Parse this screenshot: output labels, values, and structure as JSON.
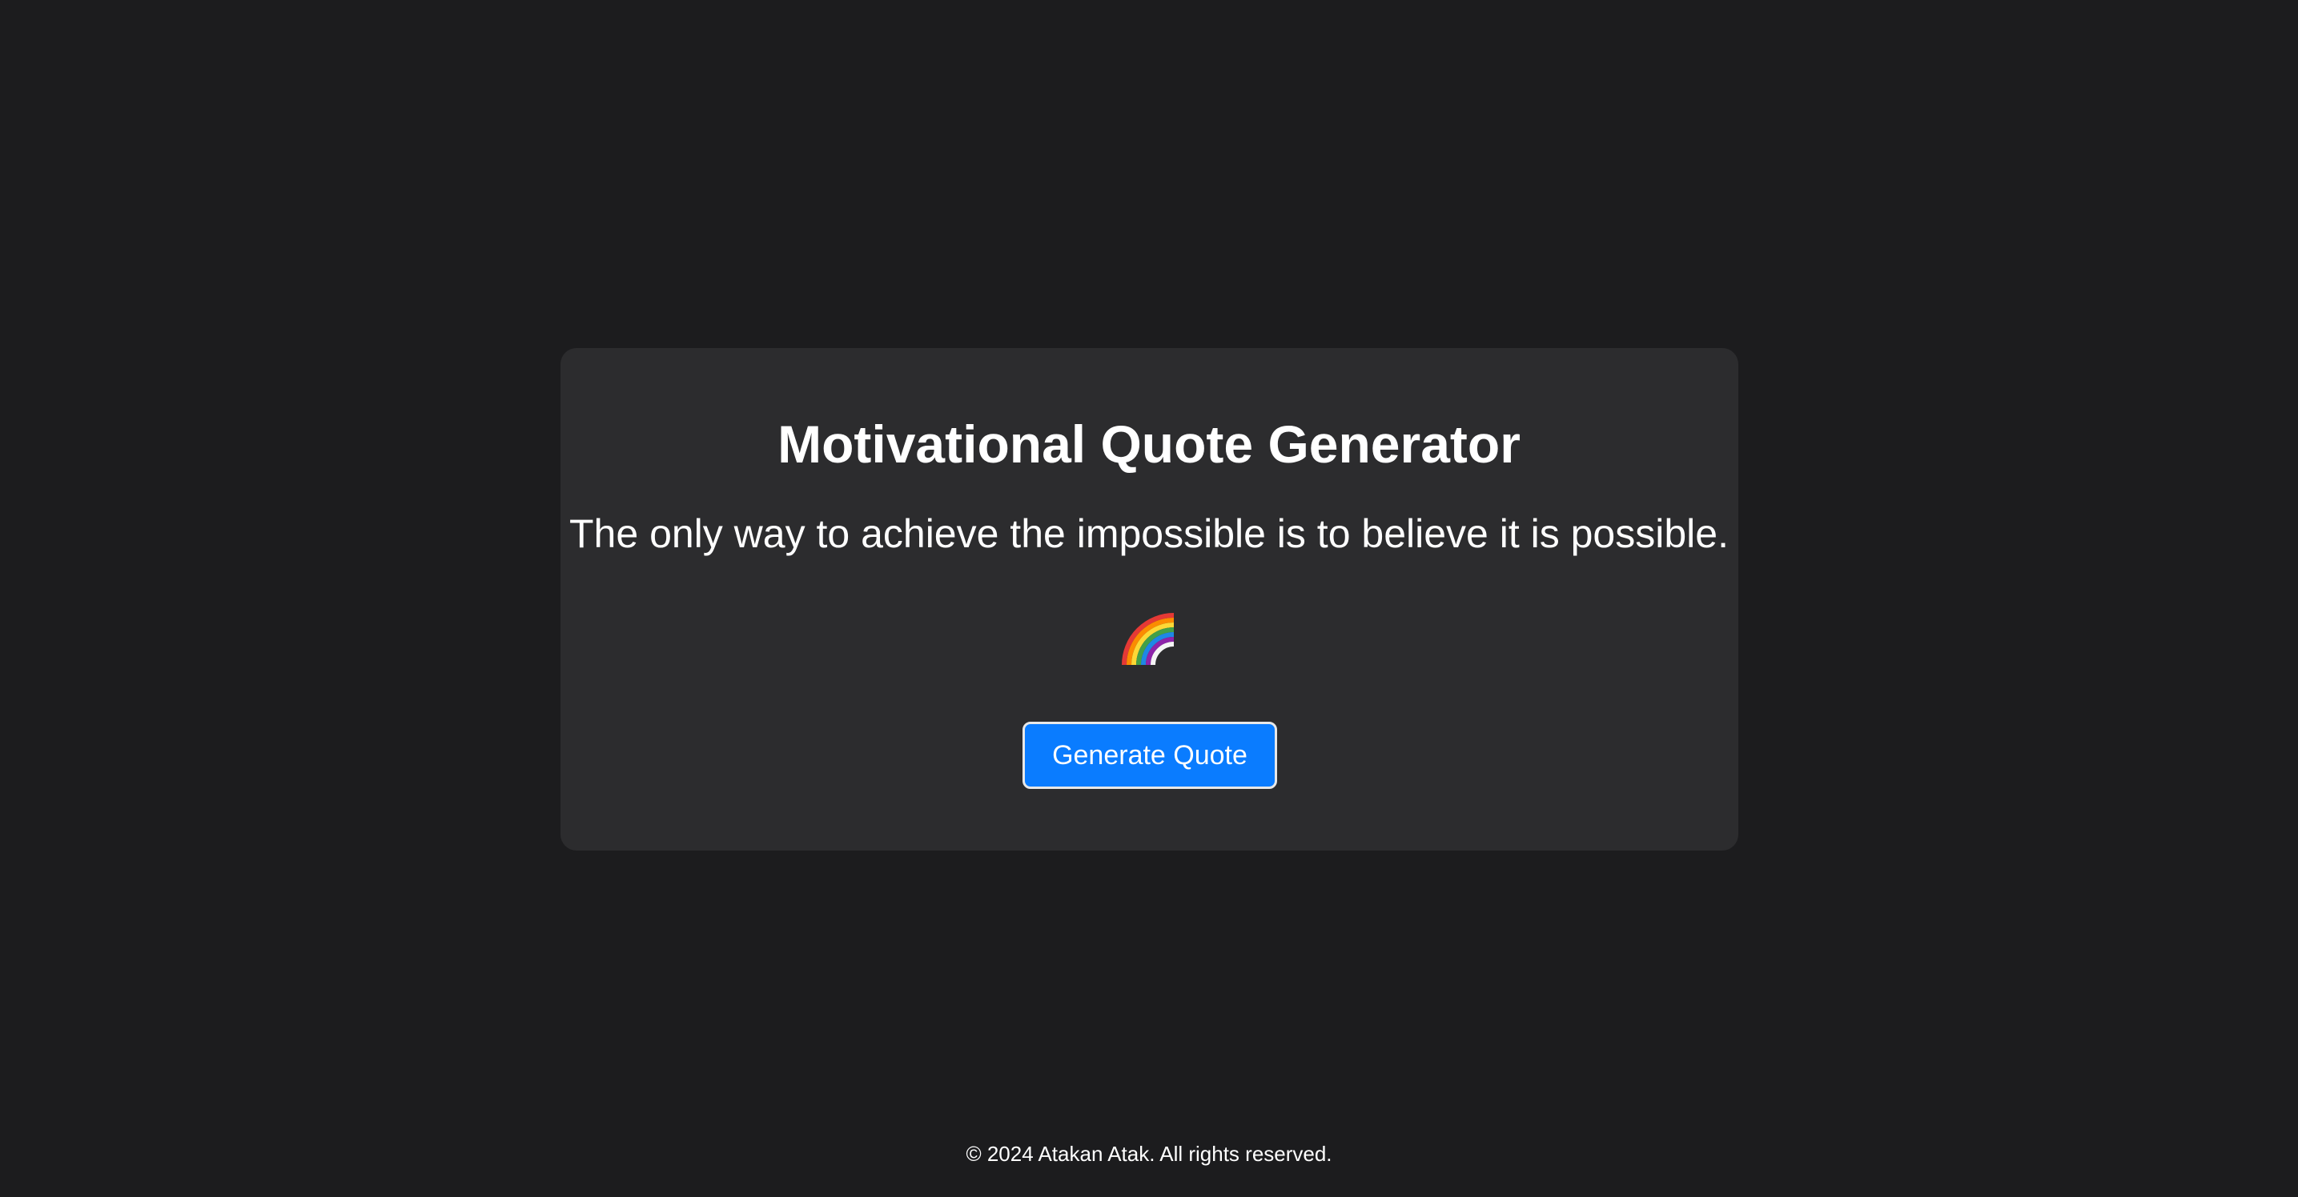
{
  "card": {
    "title": "Motivational Quote Generator",
    "quote": "The only way to achieve the impossible is to believe it is possible.",
    "emoji_icon": "rainbow-icon",
    "button_label": "Generate Quote"
  },
  "footer": {
    "text": "© 2024 Atakan Atak. All rights reserved."
  },
  "colors": {
    "background": "#1c1c1e",
    "card": "#2c2c2e",
    "button": "#0a7cff",
    "text": "#ffffff"
  }
}
